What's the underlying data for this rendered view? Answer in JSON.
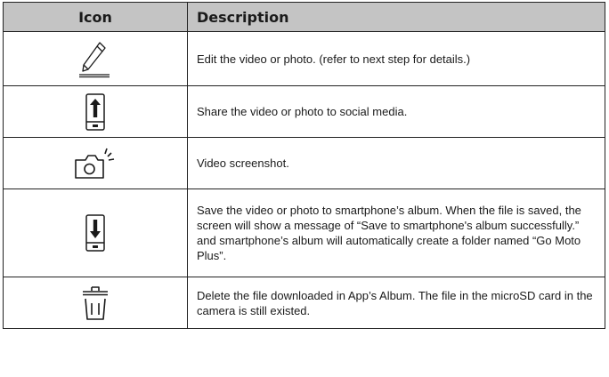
{
  "table": {
    "headers": {
      "icon": "Icon",
      "description": "Description"
    },
    "rows": [
      {
        "icon": "pencil-edit-icon",
        "description": "Edit the video or photo. (refer to next step for details.)"
      },
      {
        "icon": "phone-share-icon",
        "description": "Share the video or photo to social media."
      },
      {
        "icon": "camera-screenshot-icon",
        "description": "Video screenshot."
      },
      {
        "icon": "phone-save-icon",
        "description": "Save the video or photo to smartphone’s album. When the file is saved, the screen will show a message of “Save to smartphone's album successfully.” and smartphone’s album will automatically create a folder named “Go Moto Plus”."
      },
      {
        "icon": "trash-icon",
        "description": "Delete the file downloaded in App’s Album. The file in the microSD card in the camera is still existed."
      }
    ]
  },
  "colors": {
    "header_bg": "#c4c4c4",
    "border": "#222222",
    "icon_stroke": "#1a1a1a"
  }
}
